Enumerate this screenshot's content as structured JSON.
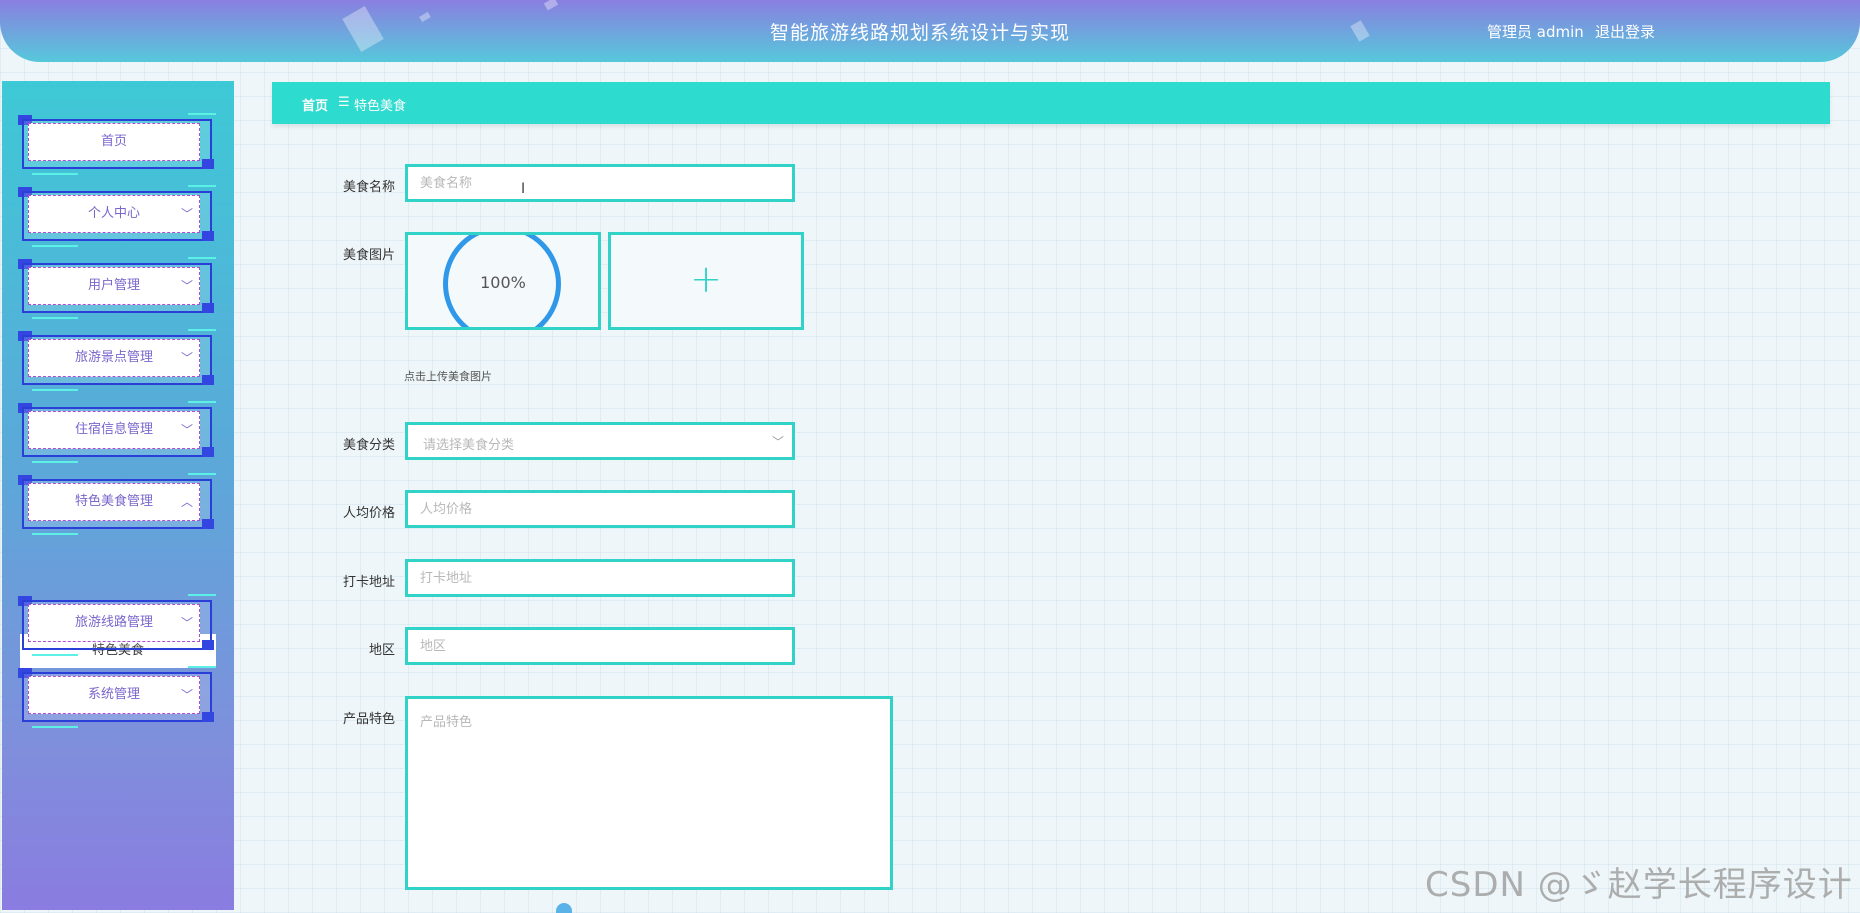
{
  "header": {
    "title": "智能旅游线路规划系统设计与实现",
    "user": "管理员 admin",
    "logout": "退出登录"
  },
  "sidebar": {
    "items": [
      {
        "label": "首页"
      },
      {
        "label": "个人中心"
      },
      {
        "label": "用户管理"
      },
      {
        "label": "旅游景点管理"
      },
      {
        "label": "住宿信息管理"
      },
      {
        "label": "特色美食管理"
      },
      {
        "label": "旅游线路管理"
      },
      {
        "label": "系统管理"
      }
    ],
    "submenu": {
      "label": "特色美食"
    }
  },
  "breadcrumb": {
    "home": "首页",
    "separator": "☰",
    "current": "特色美食"
  },
  "form": {
    "name": {
      "label": "美食名称",
      "placeholder": "美食名称"
    },
    "image": {
      "label": "美食图片",
      "progress": "100%",
      "hint": "点击上传美食图片"
    },
    "category": {
      "label": "美食分类",
      "placeholder": "请选择美食分类"
    },
    "price": {
      "label": "人均价格",
      "placeholder": "人均价格"
    },
    "address": {
      "label": "打卡地址",
      "placeholder": "打卡地址"
    },
    "region": {
      "label": "地区",
      "placeholder": "地区"
    },
    "feature": {
      "label": "产品特色",
      "placeholder": "产品特色"
    }
  },
  "watermark": "CSDN @ゞ赵学长程序设计",
  "colors": {
    "accent": "#31d3c8",
    "header_start": "#8a7fe0",
    "menu_text": "#7a66cc",
    "progress": "#2f98e8"
  }
}
